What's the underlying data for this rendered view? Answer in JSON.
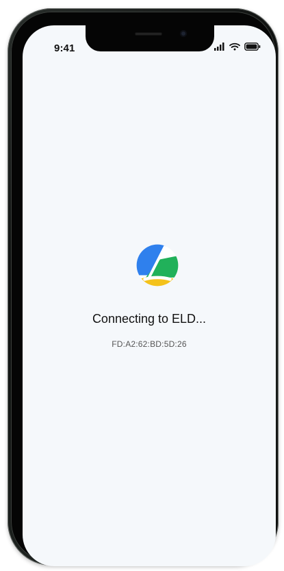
{
  "status_bar": {
    "time": "9:41",
    "icons": [
      "signal-icon",
      "wifi-icon",
      "battery-icon"
    ]
  },
  "main": {
    "logo_icon": "app-logo-icon",
    "status_text": "Connecting to ELD...",
    "device_id": "FD:A2:62:BD:5D:26"
  },
  "colors": {
    "logo_blue": "#2f80ed",
    "logo_green": "#21b15a",
    "logo_yellow": "#f4c21b",
    "screen_bg": "#f5f8fb"
  }
}
